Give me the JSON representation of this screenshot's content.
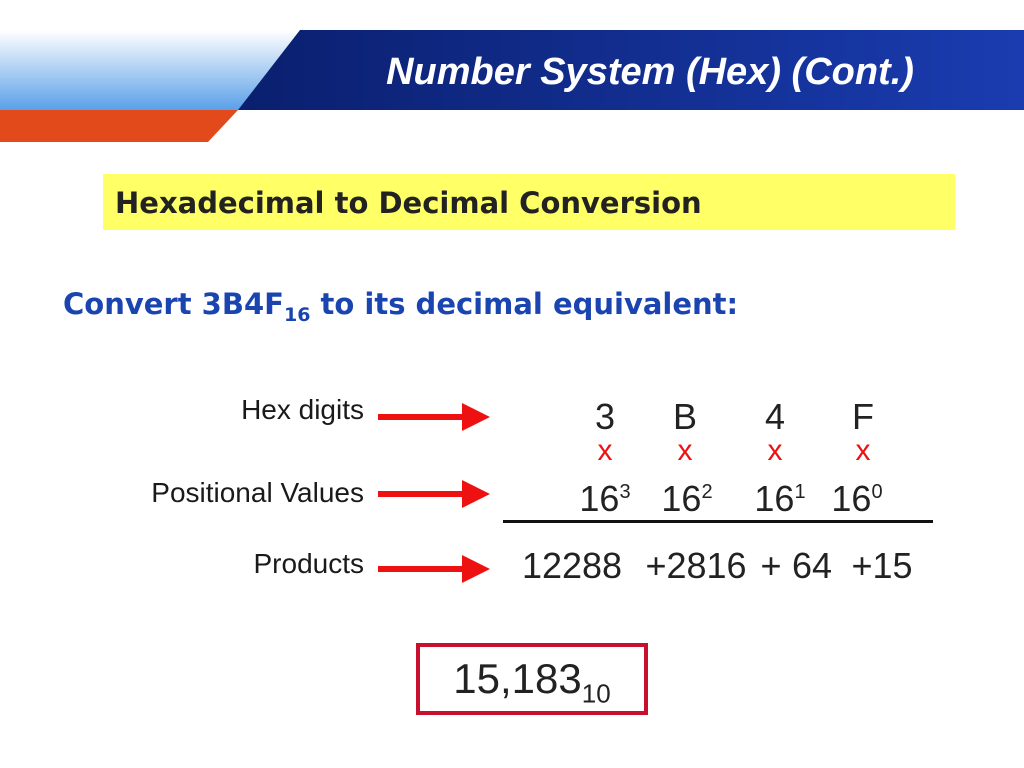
{
  "slide": {
    "title": "Number System (Hex) (Cont.)",
    "subtitle": "Hexadecimal to Decimal Conversion",
    "prompt": {
      "before": "Convert 3B4F",
      "base": "16",
      "after": " to its decimal equivalent:"
    },
    "rows": {
      "hex_digits_label": "Hex digits",
      "positional_label": "Positional Values",
      "products_label": "Products"
    },
    "hex_digits": [
      "3",
      "B",
      "4",
      "F"
    ],
    "multiply_sign": "x",
    "positional": [
      {
        "base": "16",
        "exp": "3"
      },
      {
        "base": "16",
        "exp": "2"
      },
      {
        "base": "16",
        "exp": "1"
      },
      {
        "base": "16",
        "exp": "0"
      }
    ],
    "products": [
      "12288",
      "+2816",
      "+",
      "64",
      "+15"
    ],
    "result": {
      "value": "15,183",
      "base": "10"
    }
  },
  "colors": {
    "header_dark_blue": "#0c2a8c",
    "header_light_blue": "#5aa0e8",
    "header_orange": "#e24a1c",
    "highlight_yellow": "#ffff66",
    "prompt_blue": "#1a44b0",
    "accent_red": "#ee1111",
    "box_red": "#c8102e"
  }
}
